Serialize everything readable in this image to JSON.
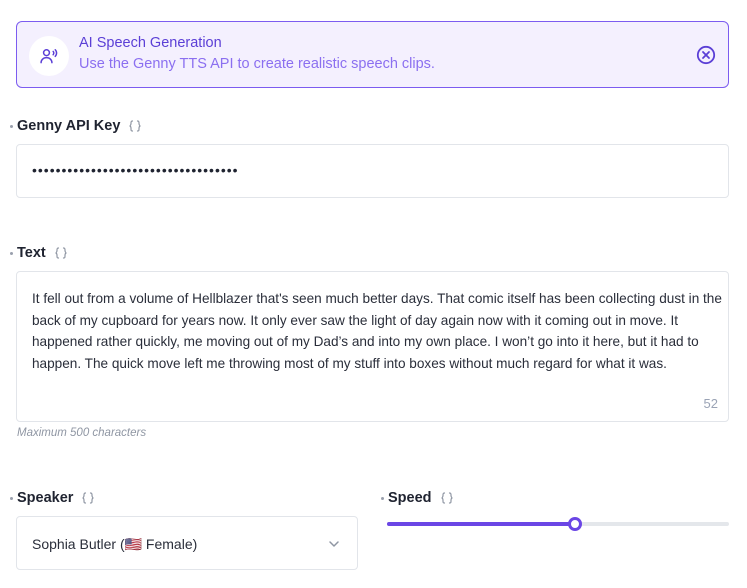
{
  "banner": {
    "title": "AI Speech Generation",
    "subtitle": "Use the Genny TTS API to create realistic speech clips.",
    "icon": "voice-icon",
    "close_icon": "close-circle-icon",
    "accent": "#7c5cf0"
  },
  "api_key": {
    "label": "Genny API Key",
    "value": "•••••••••••••••••••••••••••••••••••"
  },
  "text": {
    "label": "Text",
    "value": "It fell out from a volume of Hellblazer that's seen much better days. That comic itself has been collecting dust in the back of my cupboard for years now. It only ever saw the light of day again now with it coming out in move. It happened rather quickly, me moving out of my Dad’s and into my own place. I won’t go into it here, but it had to happen. The quick move left me throwing most of my stuff into boxes without much regard for what it was.",
    "char_count": "52",
    "hint": "Maximum 500 characters"
  },
  "speaker": {
    "label": "Speaker",
    "value": "Sophia Butler (🇺🇸 Female)"
  },
  "speed": {
    "label": "Speed",
    "level": 0.55
  }
}
